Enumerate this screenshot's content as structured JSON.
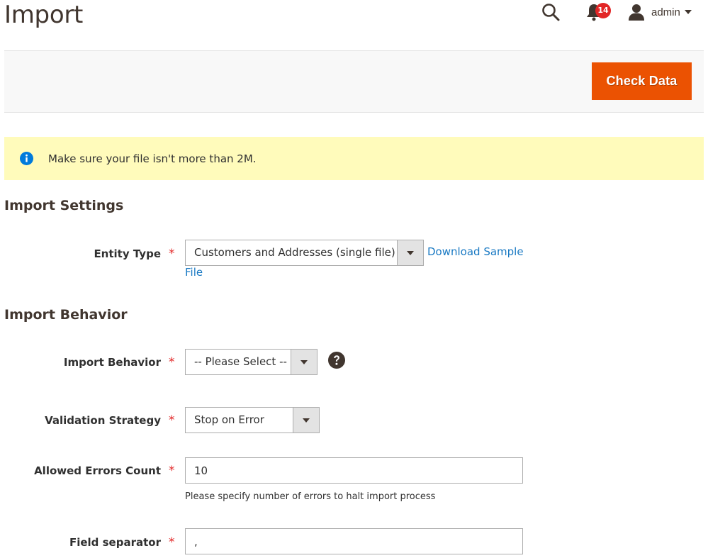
{
  "header": {
    "title": "Import",
    "notifications_count": "14",
    "user_name": "admin"
  },
  "actions": {
    "check_data_label": "Check Data"
  },
  "notice": {
    "text": "Make sure your file isn't more than 2M."
  },
  "import_settings": {
    "section_title": "Import Settings",
    "entity_type": {
      "label": "Entity Type",
      "value": "Customers and Addresses (single file)"
    },
    "download_link_line1": "Download Sample",
    "download_link_line2": "File"
  },
  "import_behavior": {
    "section_title": "Import Behavior",
    "behavior": {
      "label": "Import Behavior",
      "value": "-- Please Select --"
    },
    "validation": {
      "label": "Validation Strategy",
      "value": "Stop on Error"
    },
    "errors_count": {
      "label": "Allowed Errors Count",
      "value": "10",
      "note": "Please specify number of errors to halt import process"
    },
    "field_separator": {
      "label": "Field separator",
      "value": ","
    }
  },
  "required_marker": "*",
  "colors": {
    "accent": "#eb5202",
    "link": "#1979c3",
    "notice_bg": "#fffbbb",
    "badge": "#e22626"
  },
  "icons": [
    "search-icon",
    "bell-icon",
    "user-icon",
    "info-icon",
    "help-icon"
  ]
}
